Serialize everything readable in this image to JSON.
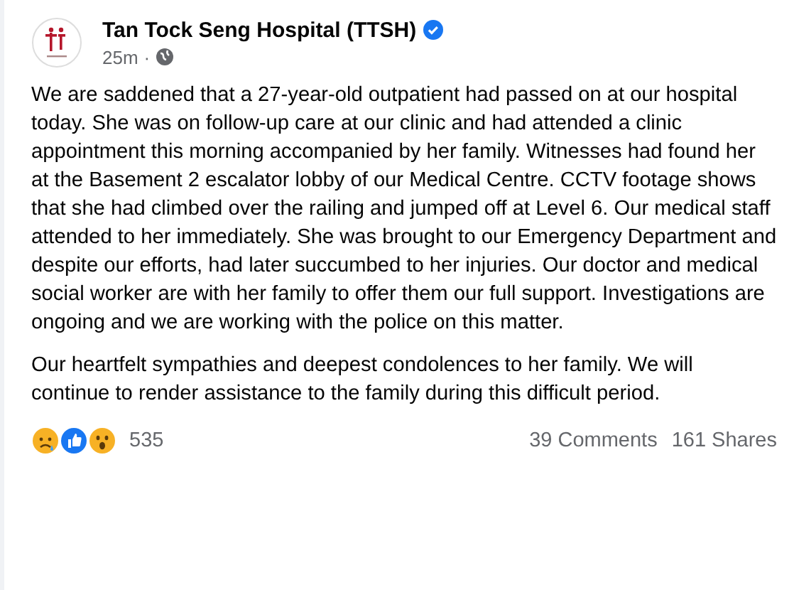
{
  "post": {
    "author": "Tan Tock Seng Hospital (TTSH)",
    "verified": true,
    "time": "25m",
    "separator": "·",
    "paragraphs": [
      "We are saddened that a 27-year-old outpatient had passed on at our hospital today. She was on follow-up care at our clinic and had attended a clinic appointment this morning accompanied by her family. Witnesses had found her at the Basement 2 escalator lobby of our Medical Centre. CCTV footage shows that she had climbed over the railing and jumped off at Level 6. Our medical staff attended to her immediately. She was brought to our Emergency Department and despite our efforts, had later succumbed to her injuries. Our doctor and medical social worker are with her family to offer them our full support. Investigations are ongoing and we are working with the police on this matter.",
      "Our heartfelt sympathies and deepest condolences to her family. We will continue to render assistance to the family during this difficult period."
    ],
    "reactions": [
      {
        "kind": "sad"
      },
      {
        "kind": "like"
      },
      {
        "kind": "wow"
      }
    ],
    "reaction_count": "535",
    "comments": "39 Comments",
    "shares": "161 Shares"
  }
}
